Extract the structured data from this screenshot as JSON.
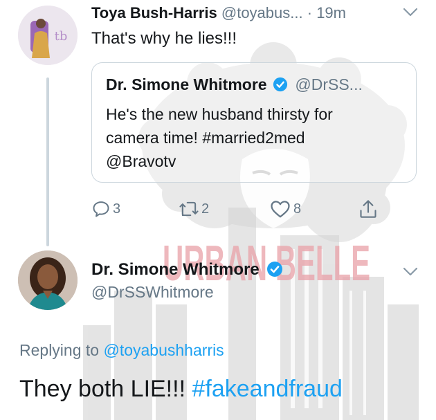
{
  "watermark": {
    "text": "URBAN BELLE",
    "color": "#e9a1a8"
  },
  "tweet1": {
    "author_name": "Toya Bush-Harris",
    "author_handle": "@toyabus...",
    "separator": "·",
    "time": "19m",
    "text": "That's why he lies!!!",
    "avatar_colors": [
      "#e7e3e8",
      "#d9a64a",
      "#9a68b5"
    ]
  },
  "quoted": {
    "author_name": "Dr. Simone Whitmore",
    "author_handle": "@DrSS...",
    "text_lines": [
      "He's the new husband thirsty for",
      "camera time! #married2med",
      "@Bravotv"
    ]
  },
  "actions": {
    "reply_count": "3",
    "retweet_count": "2",
    "like_count": "8"
  },
  "tweet2": {
    "author_name": "Dr. Simone Whitmore",
    "author_handle": "@DrSSWhitmore",
    "replying_label": "Replying to",
    "replying_handle": "@toyabushharris",
    "text_plain": "They both LIE!!! ",
    "text_hashtag": "#fakeandfraud"
  },
  "colors": {
    "accent": "#1da1f2",
    "text": "#14171a",
    "muted": "#657786",
    "border": "#ccd6dd"
  }
}
